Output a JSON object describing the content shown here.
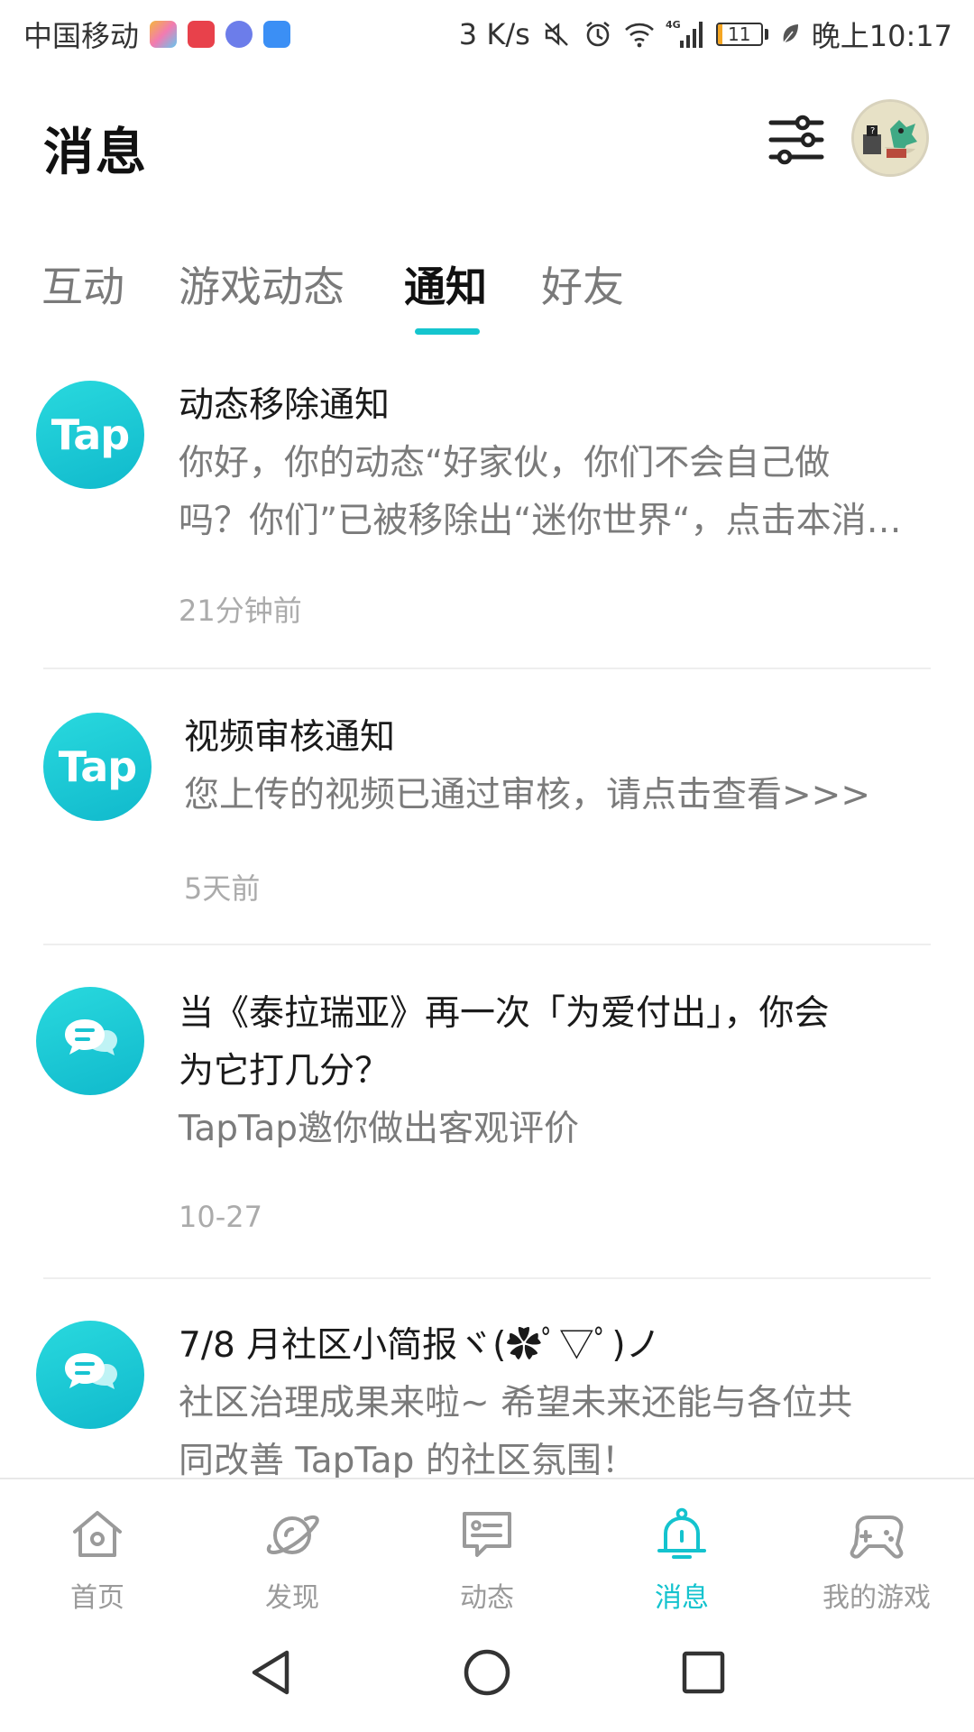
{
  "status_bar": {
    "carrier": "中国移动",
    "network_speed": "3 K/s",
    "signal_type": "4G",
    "battery_level": "11",
    "battery_fraction": 0.11,
    "time": "晚上10:17",
    "icons": [
      "message-app-icon",
      "huawei-app-icon",
      "music-app-icon",
      "shield-app-icon",
      "mute-icon",
      "alarm-icon",
      "wifi-icon",
      "signal-icon",
      "battery-icon",
      "leaf-icon"
    ],
    "app_colors": [
      "#f5b63d",
      "#e8414b",
      "#6c7dea",
      "#3b8ff5"
    ]
  },
  "header": {
    "title": "消息",
    "filter_icon": "sliders-icon",
    "avatar_icon": "user-avatar"
  },
  "tabs": {
    "items": [
      {
        "label": "互动",
        "active": false
      },
      {
        "label": "游戏动态",
        "active": false
      },
      {
        "label": "通知",
        "active": true
      },
      {
        "label": "好友",
        "active": false
      }
    ],
    "indicator_color": "#15c5ce"
  },
  "notifications": [
    {
      "avatar_type": "tap-logo",
      "avatar_text": "Tap",
      "title": "动态移除通知",
      "body_line1": "你好，你的动态“好家伙，你们不会自己做",
      "body_line2": "吗？你们”已被移除出“迷你世界“，点击本消…",
      "time": "21分钟前"
    },
    {
      "avatar_type": "tap-logo",
      "avatar_text": "Tap",
      "title": "视频审核通知",
      "body_line1": "您上传的视频已通过审核，请点击查看>>>",
      "time": "5天前"
    },
    {
      "avatar_type": "chat-bubble-icon",
      "title_line1": "当《泰拉瑞亚》再一次「为爱付出」，你会",
      "title_line2": "为它打几分？",
      "body_line1": "TapTap邀你做出客观评价",
      "time": "10-27"
    },
    {
      "avatar_type": "chat-bubble-icon",
      "title": "7/8 月社区小简报ヾ(✿ﾟ▽ﾟ)ノ",
      "body_line1": "社区治理成果来啦~ 希望未来还能与各位共",
      "body_line2": "同改善 TapTap 的社区氛围！"
    }
  ],
  "bottom_nav": {
    "items": [
      {
        "label": "首页",
        "icon": "home-icon",
        "active": false
      },
      {
        "label": "发现",
        "icon": "planet-icon",
        "active": false
      },
      {
        "label": "动态",
        "icon": "feed-icon",
        "active": false
      },
      {
        "label": "消息",
        "icon": "bell-icon",
        "active": true
      },
      {
        "label": "我的游戏",
        "icon": "gamepad-icon",
        "active": false
      }
    ],
    "active_color": "#14c3ce",
    "inactive_color": "#9a9a9a"
  },
  "android_nav": {
    "icons": [
      "back-icon",
      "home-circle-icon",
      "recents-icon"
    ]
  }
}
